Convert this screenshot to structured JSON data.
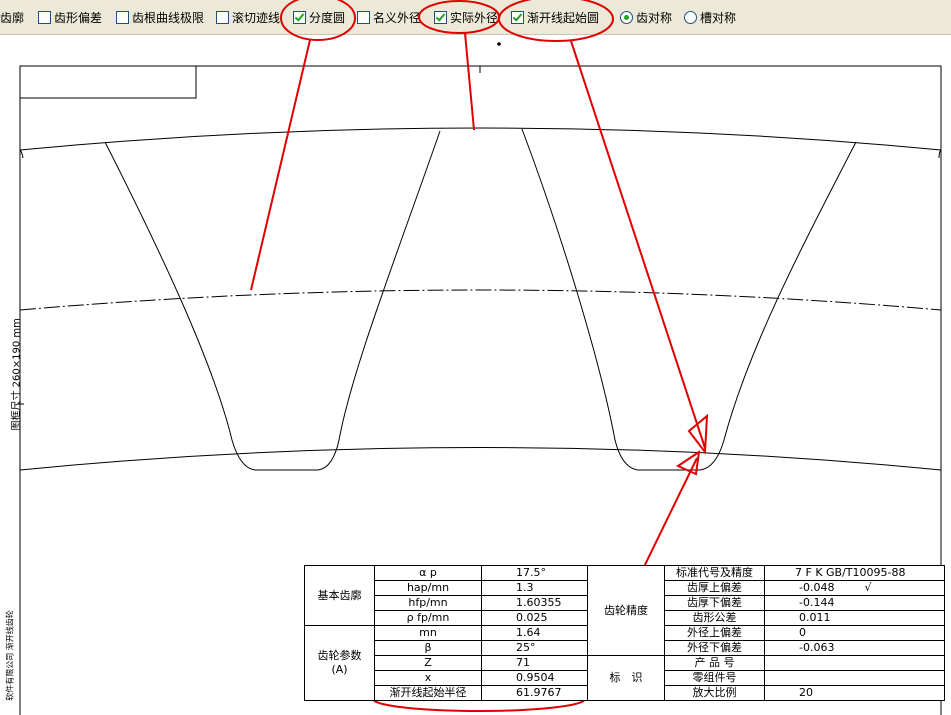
{
  "toolbar": {
    "tooth_profile_partial": "齿廓",
    "options": [
      {
        "label": "齿形偏差",
        "checked": false
      },
      {
        "label": "齿根曲线极限",
        "checked": false
      },
      {
        "label": "滚切迹线",
        "checked": false
      },
      {
        "label": "分度圆",
        "checked": true
      },
      {
        "label": "名义外径",
        "checked": false
      },
      {
        "label": "实际外径",
        "checked": true
      },
      {
        "label": "渐开线起始圆",
        "checked": true
      }
    ],
    "radios": [
      {
        "label": "齿对称",
        "selected": true
      },
      {
        "label": "槽对称",
        "selected": false
      }
    ]
  },
  "drawing": {
    "side_label_size": "图框尺寸 260×190 mm",
    "side_label_company": "软件有限公司 渐开线齿轮",
    "line_color": "#000000",
    "annotation_color": "#e00000"
  },
  "spec_table": {
    "group_basic": "基本齿廓",
    "group_params": "齿轮参数",
    "group_params_unit": "(A)",
    "group_accuracy": "齿轮精度",
    "group_identification": "标　识",
    "params": [
      {
        "name": "α p",
        "value": "17.5°"
      },
      {
        "name": "hap/mn",
        "value": "1.3"
      },
      {
        "name": "hfp/mn",
        "value": "1.60355"
      },
      {
        "name": "ρ fp/mn",
        "value": "0.025"
      },
      {
        "name": "mn",
        "value": "1.64"
      },
      {
        "name": "β",
        "value": "25°"
      },
      {
        "name": "Z",
        "value": "71"
      },
      {
        "name": "x",
        "value": "0.9504"
      },
      {
        "name": "渐开线起始半径",
        "value": "61.9767"
      }
    ],
    "right": [
      {
        "name": "标准代号及精度",
        "value": "7 F K GB/T10095-88",
        "mark": ""
      },
      {
        "name": "齿厚上偏差",
        "value": "-0.048",
        "mark": "√"
      },
      {
        "name": "齿厚下偏差",
        "value": "-0.144",
        "mark": ""
      },
      {
        "name": "齿形公差",
        "value": "0.011",
        "mark": ""
      },
      {
        "name": "外径上偏差",
        "value": "0",
        "mark": ""
      },
      {
        "name": "外径下偏差",
        "value": "-0.063",
        "mark": ""
      },
      {
        "name": "产 品 号",
        "value": "",
        "mark": ""
      },
      {
        "name": "零组件号",
        "value": "",
        "mark": ""
      },
      {
        "name": "放大比例",
        "value": "20",
        "mark": ""
      }
    ]
  }
}
